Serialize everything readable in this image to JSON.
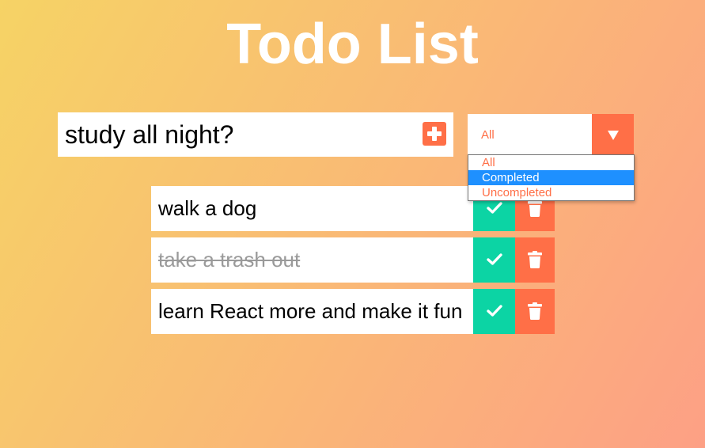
{
  "app": {
    "title": "Todo List"
  },
  "input": {
    "value": "study all night?",
    "add_icon": "plus-square-icon"
  },
  "filter": {
    "selected": "All",
    "arrow_icon": "triangle-down-icon",
    "options": [
      "All",
      "Completed",
      "Uncompleted"
    ],
    "highlighted": "Completed"
  },
  "todos": [
    {
      "text": "walk a dog",
      "completed": false
    },
    {
      "text": "take a trash out",
      "completed": true
    },
    {
      "text": "learn React more and make it fun",
      "completed": false
    }
  ],
  "icons": {
    "complete": "check-icon",
    "delete": "trash-icon"
  },
  "colors": {
    "gradient_start": "#f6d365",
    "gradient_end": "#fda085",
    "accent": "#ff6f47",
    "complete": "#0cd4a4",
    "highlight": "#1e90ff"
  }
}
